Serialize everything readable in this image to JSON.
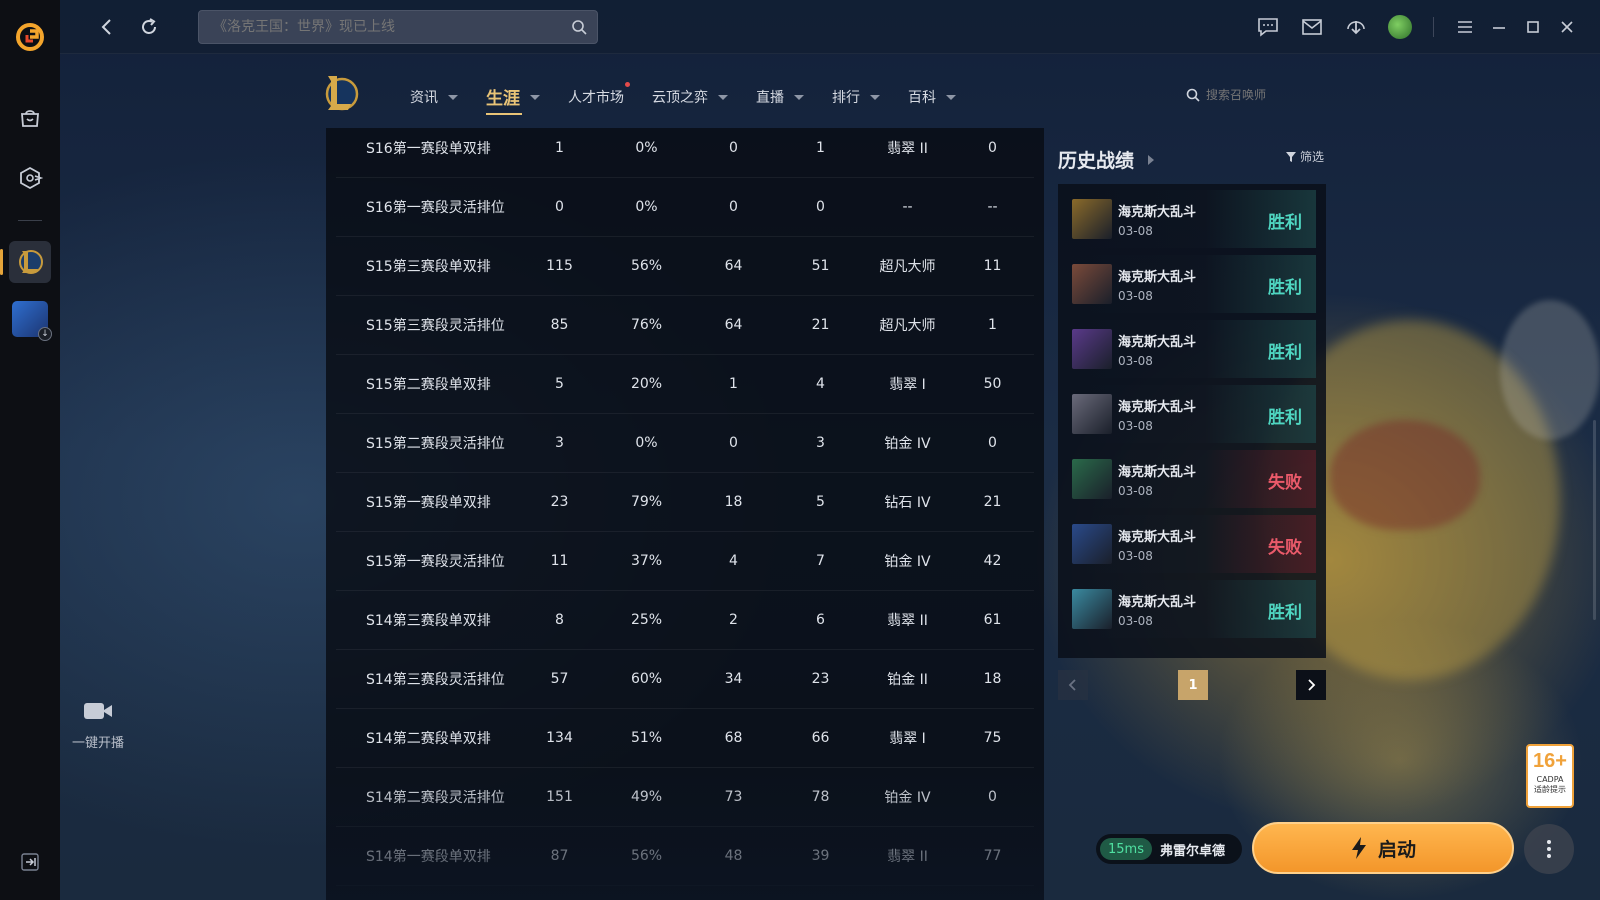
{
  "topbar": {
    "search_placeholder": "《洛克王国：世界》现已上线"
  },
  "sidebar": {
    "stream_label": "一键开播"
  },
  "lol_nav": {
    "tabs": [
      {
        "label": "资讯",
        "caret": true,
        "dot": false,
        "active": false
      },
      {
        "label": "生涯",
        "caret": true,
        "dot": false,
        "active": true
      },
      {
        "label": "人才市场",
        "caret": false,
        "dot": true,
        "active": false
      },
      {
        "label": "云顶之弈",
        "caret": true,
        "dot": false,
        "active": false
      },
      {
        "label": "直播",
        "caret": true,
        "dot": false,
        "active": false
      },
      {
        "label": "排行",
        "caret": true,
        "dot": false,
        "active": false
      },
      {
        "label": "百科",
        "caret": true,
        "dot": false,
        "active": false
      }
    ],
    "search_placeholder": "搜索召唤师"
  },
  "season_table": {
    "rows": [
      [
        "S16第一赛段单双排",
        "1",
        "0%",
        "0",
        "1",
        "翡翠 II",
        "0"
      ],
      [
        "S16第一赛段灵活排位",
        "0",
        "0%",
        "0",
        "0",
        "--",
        "--"
      ],
      [
        "S15第三赛段单双排",
        "115",
        "56%",
        "64",
        "51",
        "超凡大师",
        "11"
      ],
      [
        "S15第三赛段灵活排位",
        "85",
        "76%",
        "64",
        "21",
        "超凡大师",
        "1"
      ],
      [
        "S15第二赛段单双排",
        "5",
        "20%",
        "1",
        "4",
        "翡翠 I",
        "50"
      ],
      [
        "S15第二赛段灵活排位",
        "3",
        "0%",
        "0",
        "3",
        "铂金 IV",
        "0"
      ],
      [
        "S15第一赛段单双排",
        "23",
        "79%",
        "18",
        "5",
        "钻石 IV",
        "21"
      ],
      [
        "S15第一赛段灵活排位",
        "11",
        "37%",
        "4",
        "7",
        "铂金 IV",
        "42"
      ],
      [
        "S14第三赛段单双排",
        "8",
        "25%",
        "2",
        "6",
        "翡翠 II",
        "61"
      ],
      [
        "S14第三赛段灵活排位",
        "57",
        "60%",
        "34",
        "23",
        "铂金 II",
        "18"
      ],
      [
        "S14第二赛段单双排",
        "134",
        "51%",
        "68",
        "66",
        "翡翠 I",
        "75"
      ],
      [
        "S14第二赛段灵活排位",
        "151",
        "49%",
        "73",
        "78",
        "铂金 IV",
        "0"
      ],
      [
        "S14第一赛段单双排",
        "87",
        "56%",
        "48",
        "39",
        "翡翠 II",
        "77"
      ]
    ]
  },
  "history": {
    "title": "历史战绩",
    "filter_label": "筛选",
    "matches": [
      {
        "mode": "海克斯大乱斗",
        "date": "03-08",
        "result": "胜利",
        "win": true,
        "champ_color": "#8a6a2a"
      },
      {
        "mode": "海克斯大乱斗",
        "date": "03-08",
        "result": "胜利",
        "win": true,
        "champ_color": "#7a4a3a"
      },
      {
        "mode": "海克斯大乱斗",
        "date": "03-08",
        "result": "胜利",
        "win": true,
        "champ_color": "#5a3a8a"
      },
      {
        "mode": "海克斯大乱斗",
        "date": "03-08",
        "result": "胜利",
        "win": true,
        "champ_color": "#6a6a7a"
      },
      {
        "mode": "海克斯大乱斗",
        "date": "03-08",
        "result": "失败",
        "win": false,
        "champ_color": "#2a6a4a"
      },
      {
        "mode": "海克斯大乱斗",
        "date": "03-08",
        "result": "失败",
        "win": false,
        "champ_color": "#2a4a8a"
      },
      {
        "mode": "海克斯大乱斗",
        "date": "03-08",
        "result": "胜利",
        "win": true,
        "champ_color": "#3a8aa0"
      }
    ],
    "page": "1"
  },
  "age_badge": {
    "rating": "16+",
    "org": "CADPA",
    "tip": "适龄提示"
  },
  "launch": {
    "ping": "15ms",
    "server": "弗雷尔卓德",
    "button_label": "启动"
  },
  "colors": {
    "accent_gold": "#e9c477",
    "win": "#4fd6c1",
    "lose": "#ea5a6a",
    "launch": "#f3962a"
  }
}
